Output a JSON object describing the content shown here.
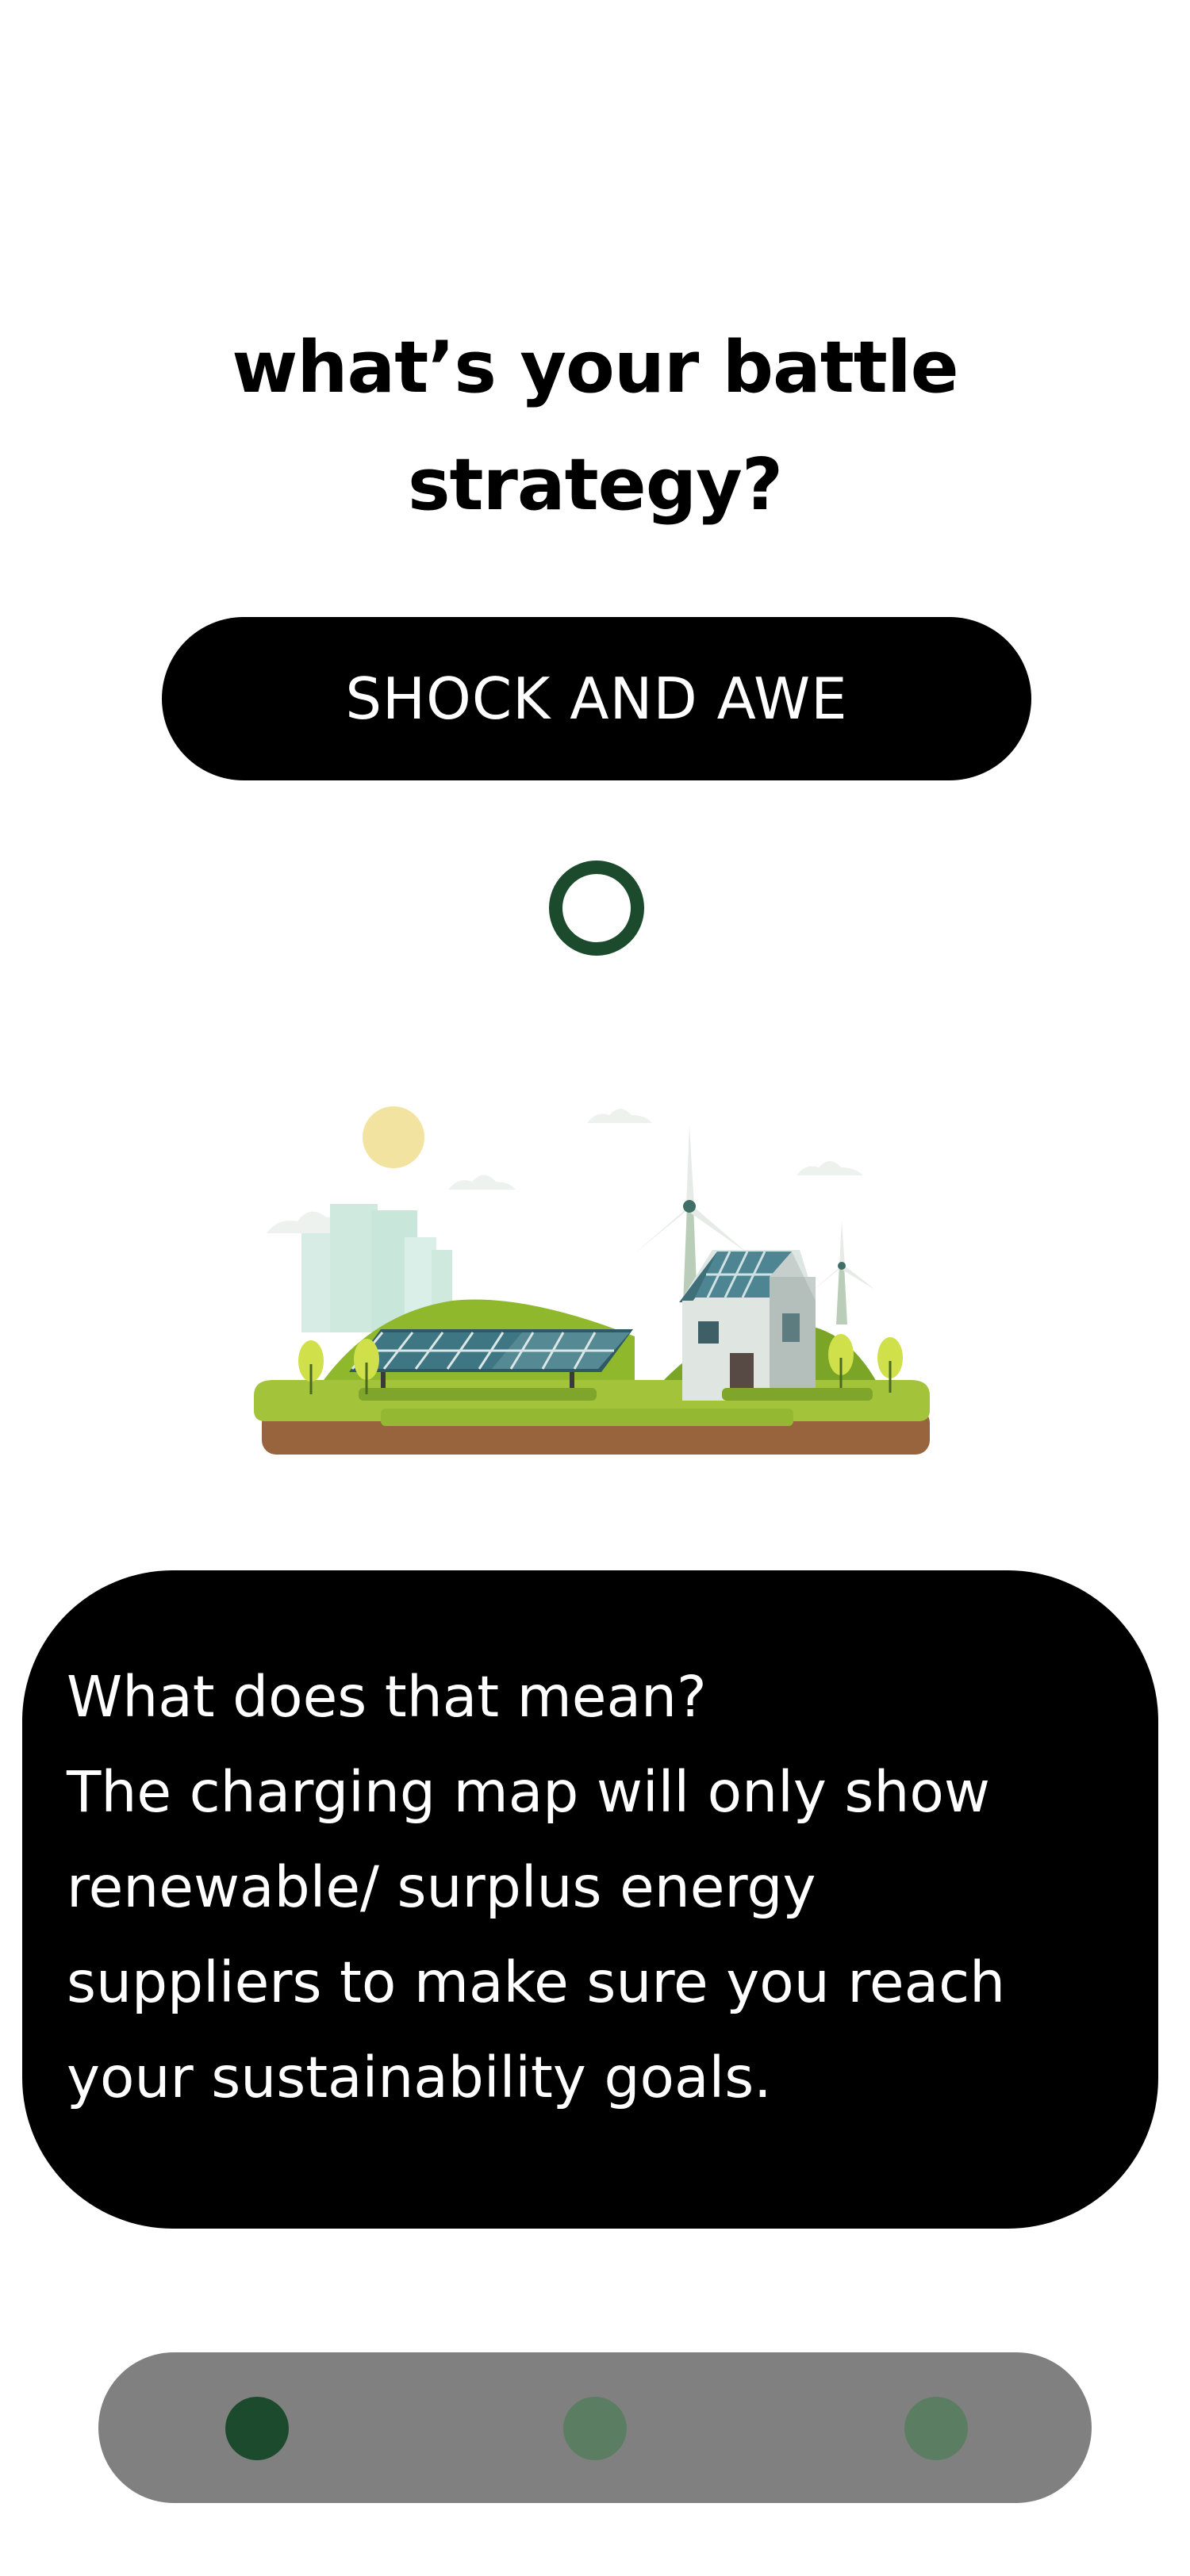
{
  "question": {
    "line1": "what’s your battle",
    "line2": "strategy?"
  },
  "option": {
    "label": "SHOCK AND AWE"
  },
  "illustration": {
    "description_icon": "renewable-energy-landscape-illustration"
  },
  "explanation": {
    "lines": [
      "What does that mean?",
      "The charging map will only show",
      "renewable/ surplus energy",
      "suppliers to make sure you reach",
      "your sustainability goals."
    ]
  },
  "pagination": {
    "total": 3,
    "active_index": 0
  },
  "colors": {
    "accent_green": "#1c4a2c",
    "inactive_dot": "#5b7e63",
    "pager_bg": "#808080",
    "card_bg": "#000000"
  }
}
